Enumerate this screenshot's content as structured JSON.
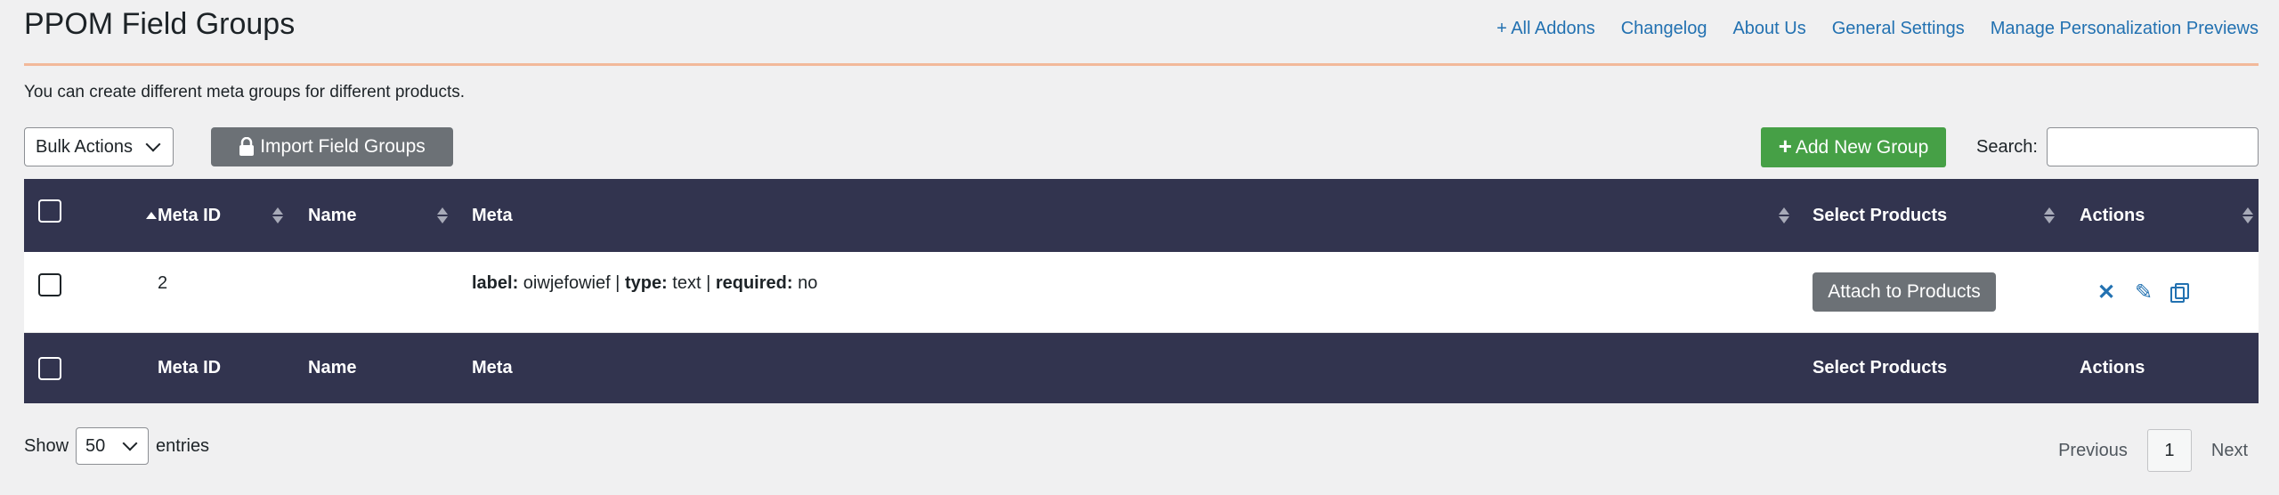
{
  "header": {
    "title": "PPOM Field Groups",
    "links": [
      "+ All Addons",
      "Changelog",
      "About Us",
      "General Settings",
      "Manage Personalization Previews"
    ]
  },
  "description": "You can create different meta groups for different products.",
  "toolbar": {
    "bulk_actions": "Bulk Actions",
    "import_label": "Import Field Groups",
    "add_label": "Add New Group",
    "search_label": "Search:"
  },
  "table": {
    "columns": [
      "Meta ID",
      "Name",
      "Meta",
      "Select Products",
      "Actions"
    ],
    "rows": [
      {
        "meta_id": "2",
        "name": "",
        "meta": {
          "label_key": "label:",
          "label_val": " oiwjefowief | ",
          "type_key": "type:",
          "type_val": " text | ",
          "required_key": "required:",
          "required_val": " no"
        },
        "attach_label": "Attach to Products"
      }
    ]
  },
  "footer": {
    "show_label": "Show",
    "page_length": "50",
    "entries_label": "entries",
    "previous": "Previous",
    "current_page": "1",
    "next": "Next"
  },
  "colors": {
    "table_header_bg": "#32344f",
    "accent_link": "#2271b1",
    "add_button": "#46a046",
    "gray_button": "#6c7176",
    "header_rule": "#f2b99a"
  },
  "icons": [
    "lock-icon",
    "plus-icon",
    "sort-icon",
    "delete-icon",
    "edit-icon",
    "copy-icon",
    "chevron-down-icon"
  ]
}
